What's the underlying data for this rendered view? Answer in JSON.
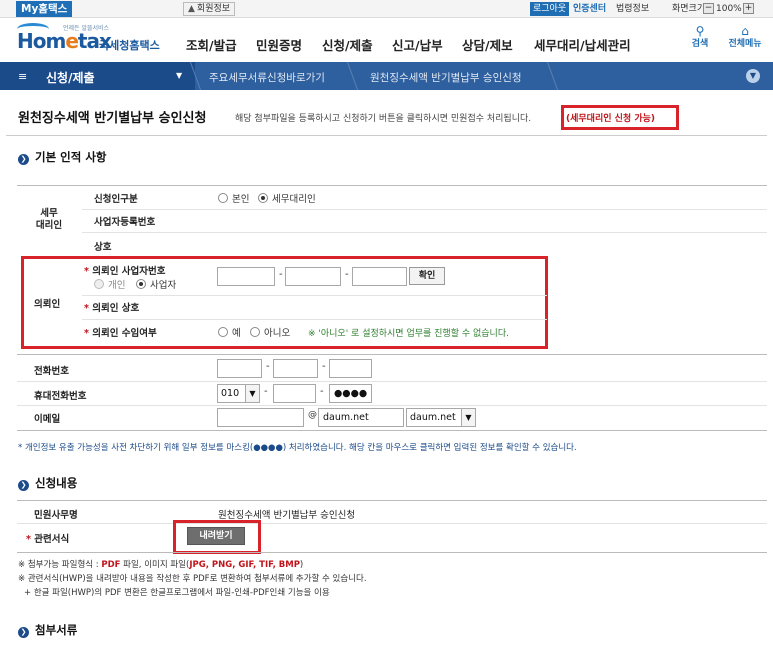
{
  "topbar": {
    "my_hometax": "My홈택스",
    "member_info": "회원정보",
    "login": "로그아웃",
    "cert_center": "인증센터",
    "legal_info": "법령정보",
    "screen_size": "화면크기",
    "zoom_out": "−",
    "zoom_value": "100%",
    "zoom_in": "+"
  },
  "header": {
    "logo_tagline": "언제든 알뜰서비스",
    "logo_word_prefix": "Hom",
    "logo_word_e": "e",
    "logo_word_suffix": "tax",
    "logo_kr": "국세청홈택스",
    "menu": [
      "조회/발급",
      "민원증명",
      "신청/제출",
      "신고/납부",
      "상담/제보",
      "세무대리/납세관리"
    ],
    "search_label": "검색",
    "allmenu_label": "전체메뉴"
  },
  "nav": {
    "title": "신청/제출",
    "crumb1": "주요세무서류신청바로가기",
    "crumb2": "원천징수세액 반기별납부 승인신청"
  },
  "page": {
    "title": "원천징수세액 반기별납부 승인신청",
    "description": "해당 첨부파일을 등록하시고 신청하기 버튼을 클릭하시면 민원접수 처리됩니다.",
    "agent_note": "(세무대리인 신청 가능)"
  },
  "basic_section": {
    "title": "기본 인적 사항",
    "agent_group_label": "세무\n대리인",
    "applicant_type_label": "신청인구분",
    "applicant_options": [
      "본인",
      "세무대리인"
    ],
    "bizno_label": "사업자등록번호",
    "company_label": "상호",
    "client_group_label": "의뢰인",
    "client_bizno_label": "의뢰인 사업자번호",
    "client_type_options": [
      "개인",
      "사업자"
    ],
    "client_bizno_1": "",
    "client_bizno_2": "",
    "client_bizno_3": "",
    "confirm_button": "확인",
    "client_company_label": "의뢰인 상호",
    "client_consent_label": "의뢰인 수임여부",
    "consent_options": [
      "예",
      "아니오"
    ],
    "consent_note": "※ '아니오' 로 설정하시면 업무를 진행할 수 없습니다.",
    "phone_label": "전화번호",
    "mobile_label": "휴대전화번호",
    "mobile_prefix": "010",
    "mobile_mid": "",
    "mobile_last": "●●●●",
    "email_label": "이메일",
    "email_id": "",
    "email_at": "@",
    "email_domain": "daum.net",
    "email_domain_select": "daum.net",
    "mask_note": "* 개인정보 유출 가능성을 사전 차단하기 위해 일부 정보를 마스킹(●●●●) 처리하였습니다. 해당 칸을 마우스로 클릭하면 입력된 정보를 확인할 수 있습니다."
  },
  "apply_section": {
    "title": "신청내용",
    "office_label": "민원사무명",
    "office_value": "원천징수세액 반기별납부 승인신청",
    "form_label": "관련서식",
    "download_button": "내려받기",
    "note1_prefix": "※ 첨부가능 파일형식 : ",
    "note1_pdf": "PDF",
    "note1_mid": " 파일, 이미지 파일(",
    "note1_img": "JPG, PNG, GIF, TIF, BMP",
    "note1_end": ")",
    "note2": "※ 관련서식(HWP)을 내려받아 내용을 작성한 후 PDF로 변환하여 첨부서류에 추가할 수 있습니다.",
    "note3": "+ 한글 파일(HWP)의 PDF 변환은 한글프로그램에서 파일-인쇄-PDF인쇄 기능을 이용"
  },
  "attach_section": {
    "title": "첨부서류"
  }
}
